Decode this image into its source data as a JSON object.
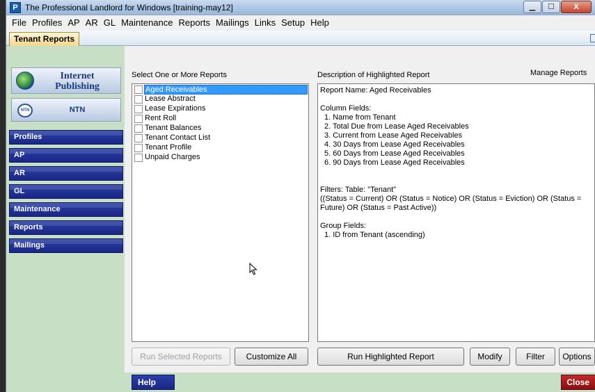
{
  "window": {
    "app_icon_letter": "P",
    "title": "The Professional Landlord for Windows [training-may12]",
    "minimize_glyph": "▁",
    "maximize_glyph": "☐",
    "close_glyph": "X"
  },
  "menu": [
    "File",
    "Profiles",
    "AP",
    "AR",
    "GL",
    "Maintenance",
    "Reports",
    "Mailings",
    "Links",
    "Setup",
    "Help"
  ],
  "tab": {
    "label": "Tenant Reports"
  },
  "sidebar": {
    "internet_publishing": {
      "line1": "Internet",
      "line2": "Publishing",
      "icon": "globe-icon"
    },
    "ntn": {
      "label": "NTN",
      "logo_text": "NTN"
    },
    "nav": [
      "Profiles",
      "AP",
      "AR",
      "GL",
      "Maintenance",
      "Reports",
      "Mailings"
    ]
  },
  "reports": {
    "select_label": "Select One or More Reports",
    "items": [
      {
        "label": "Aged Receivables",
        "selected": true
      },
      {
        "label": "Lease Abstract",
        "selected": false
      },
      {
        "label": "Lease Expirations",
        "selected": false
      },
      {
        "label": "Rent Roll",
        "selected": false
      },
      {
        "label": "Tenant Balances",
        "selected": false
      },
      {
        "label": "Tenant Contact List",
        "selected": false
      },
      {
        "label": "Tenant Profile",
        "selected": false
      },
      {
        "label": "Unpaid Charges",
        "selected": false
      }
    ]
  },
  "description": {
    "header": "Description of Highlighted Report",
    "manage_label": "Manage Reports",
    "report_name": "Report Name: Aged Receivables",
    "column_fields_header": "Column Fields:",
    "column_fields": [
      "1. Name from Tenant",
      "2. Total Due from Lease Aged Receivables",
      "3. Current from Lease Aged Receivables",
      "4. 30 Days from Lease Aged Receivables",
      "5. 60 Days from Lease Aged Receivables",
      "6. 90 Days from Lease Aged Receivables"
    ],
    "filters_header": "Filters: Table: \"Tenant\"",
    "filters_text": "((Status = Current) OR (Status = Notice) OR (Status = Eviction) OR (Status = Future) OR (Status = Past Active))",
    "group_fields_header": "Group Fields:",
    "group_fields": [
      "1. ID from Tenant (ascending)"
    ]
  },
  "buttons": {
    "run_selected": "Run Selected Reports",
    "customize_all": "Customize All",
    "run_highlighted": "Run Highlighted Report",
    "modify": "Modify",
    "filter": "Filter",
    "options": "Options"
  },
  "bottom": {
    "help": "Help",
    "close": "Close"
  }
}
